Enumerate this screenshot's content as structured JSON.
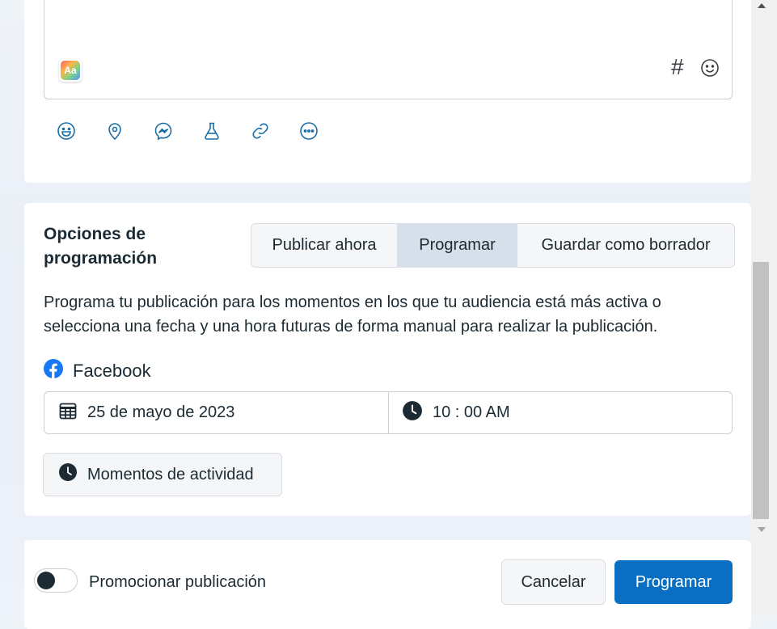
{
  "composer": {
    "text_format_label": "Aa",
    "hashtag_glyph": "#",
    "icons": [
      "emoji-icon",
      "location-pin-icon",
      "messenger-icon",
      "flask-icon",
      "link-icon",
      "more-options-icon"
    ]
  },
  "scheduling": {
    "title": "Opciones de programación",
    "tabs": [
      {
        "label": "Publicar ahora",
        "active": false
      },
      {
        "label": "Programar",
        "active": true
      },
      {
        "label": "Guardar como borrador",
        "active": false
      }
    ],
    "description": "Programa tu publicación para los momentos en los que tu audiencia está más activa o selecciona una fecha y una hora futuras de forma manual para realizar la publicación.",
    "platform": "Facebook",
    "date": "25 de mayo de 2023",
    "time": "10 : 00 AM",
    "activity_button": "Momentos de actividad"
  },
  "footer": {
    "promote_label": "Promocionar publicación",
    "promote_enabled": false,
    "cancel_label": "Cancelar",
    "schedule_label": "Programar"
  },
  "colors": {
    "primary": "#0a6fc2",
    "facebook_blue": "#1877f2",
    "active_tab": "#d6e0ea",
    "icon_blue": "#1a6ea8"
  }
}
